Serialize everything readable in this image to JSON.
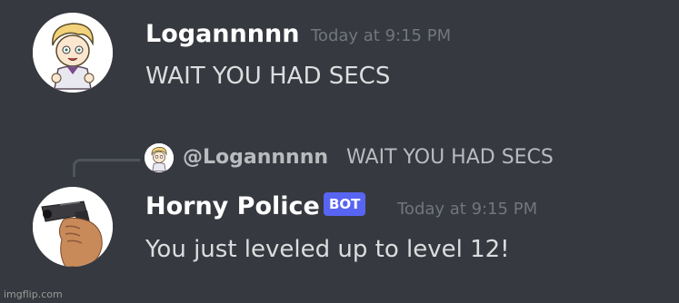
{
  "messages": [
    {
      "author": "Logannnnn",
      "timestamp": "Today at 9:15 PM",
      "content": "WAIT YOU HAD SECS",
      "avatar_icon": "cartoon-character-avatar"
    },
    {
      "author": "Horny Police",
      "bot_badge": "BOT",
      "timestamp": "Today at 9:15 PM",
      "content": "You just leveled up to level 12!",
      "avatar_icon": "hand-holding-gun-avatar",
      "reply": {
        "mention": "@Logannnnn",
        "text": "WAIT YOU HAD SECS"
      }
    }
  ],
  "watermark": "imgflip.com",
  "colors": {
    "background": "#36393f",
    "username": "#ffffff",
    "timestamp": "#72767d",
    "content": "#dcddde",
    "bot_badge": "#5865f2"
  }
}
